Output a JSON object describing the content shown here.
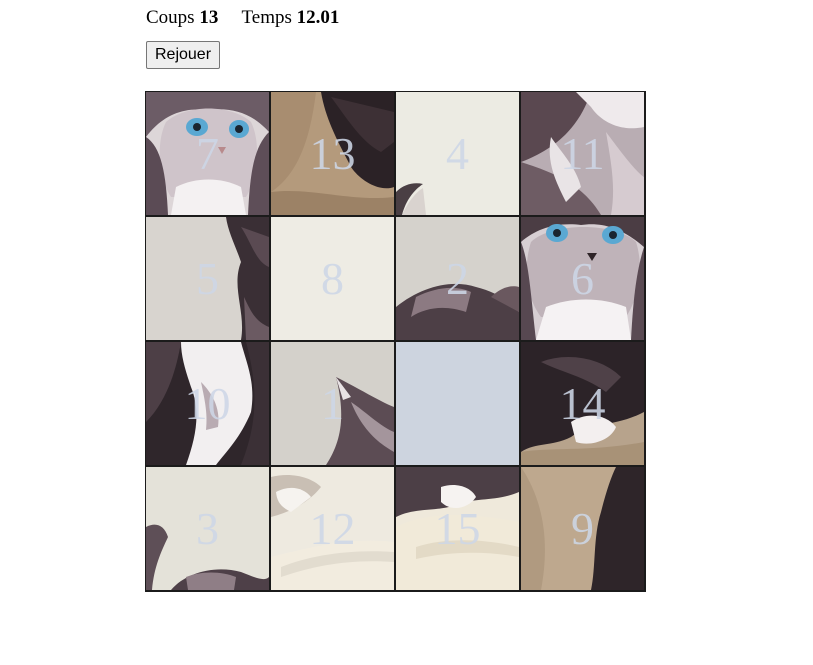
{
  "stats": {
    "moves_label": "Coups",
    "moves_value": "13",
    "time_label": "Temps",
    "time_value": "12.01"
  },
  "replay_button": {
    "label": "Rejouer"
  },
  "board": {
    "size": 4,
    "tiles": [
      "7",
      "13",
      "4",
      "11",
      "5",
      "8",
      "2",
      "6",
      "10",
      "1",
      "",
      "14",
      "3",
      "12",
      "15",
      "9"
    ],
    "empty_color": "#cdd4df",
    "number_color": "#cdd6e6",
    "image": "kitten-photo"
  }
}
